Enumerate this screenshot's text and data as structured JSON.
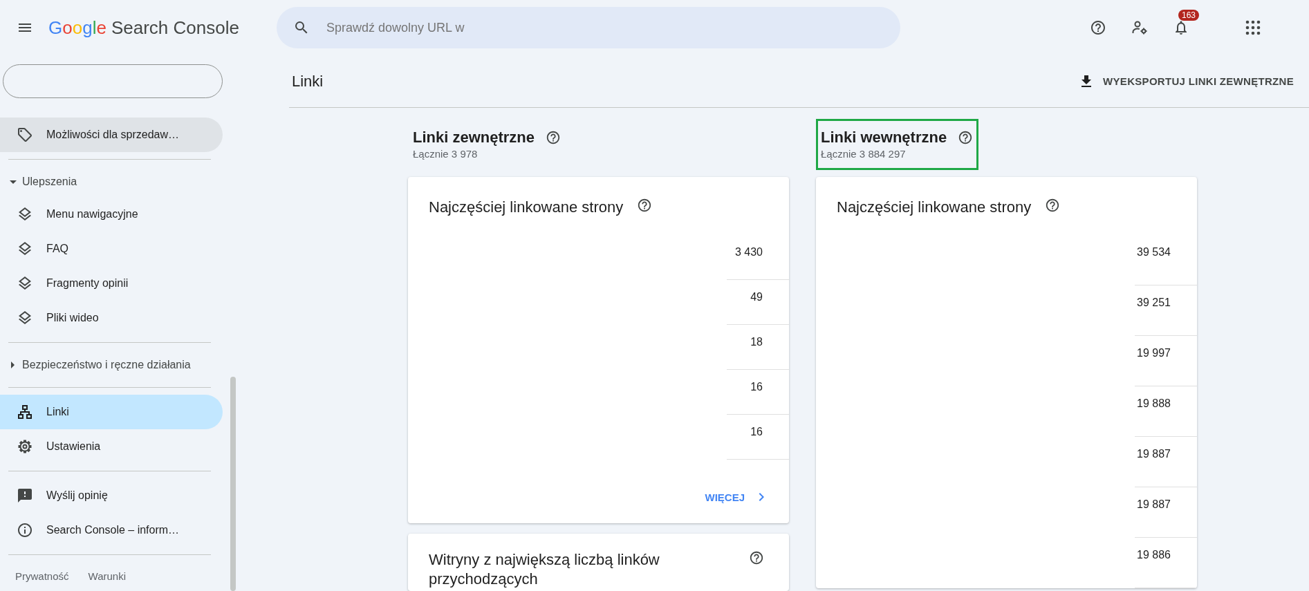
{
  "topbar": {
    "logo_brand": "Google",
    "logo_product": "Search Console",
    "search": {
      "placeholder": "Sprawdź dowolny URL w"
    },
    "notifications_badge": "163"
  },
  "sidebar": {
    "items": [
      {
        "kind": "link",
        "label": "Możliwości dla sprzedaw…",
        "selected": false,
        "highlighted": true
      },
      {
        "kind": "divider"
      },
      {
        "kind": "group",
        "label": "Ulepszenia",
        "expanded": true,
        "children": [
          {
            "kind": "link",
            "label": "Menu nawigacyjne",
            "selected": false,
            "highlighted": false
          },
          {
            "kind": "link",
            "label": "FAQ",
            "selected": false,
            "highlighted": false
          },
          {
            "kind": "link",
            "label": "Fragmenty opinii",
            "selected": false,
            "highlighted": false
          },
          {
            "kind": "link",
            "label": "Pliki wideo",
            "selected": false,
            "highlighted": false
          }
        ]
      },
      {
        "kind": "divider"
      },
      {
        "kind": "group",
        "label": "Bezpieczeństwo i ręczne działania",
        "expanded": false
      },
      {
        "kind": "divider"
      },
      {
        "kind": "link",
        "label": "Linki",
        "selected": true,
        "highlighted": false
      },
      {
        "kind": "link",
        "label": "Ustawienia",
        "selected": false,
        "highlighted": false
      },
      {
        "kind": "divider"
      },
      {
        "kind": "link",
        "label": "Wyślij opinię",
        "selected": false,
        "highlighted": false
      },
      {
        "kind": "link",
        "label": "Search Console – inform…",
        "selected": false,
        "highlighted": false
      },
      {
        "kind": "divider"
      }
    ],
    "footer_links": [
      "Prywatność",
      "Warunki"
    ]
  },
  "page": {
    "title": "Linki",
    "export_button": "WYEKSPORTUJ LINKI ZEWNĘTRZNE"
  },
  "sections": [
    {
      "title": "Linki zewnętrzne",
      "total": "Łącznie 3 978",
      "highlighted": false,
      "cards": [
        {
          "title": "Najczęściej linkowane strony",
          "rows": [
            {
              "value": "3 430"
            },
            {
              "value": "49"
            },
            {
              "value": "18"
            },
            {
              "value": "16"
            },
            {
              "value": "16"
            }
          ],
          "more_link": "WIĘCEJ"
        },
        {
          "title": "Witryny z największą liczbą linków przychodzących"
        }
      ]
    },
    {
      "title": "Linki wewnętrzne",
      "total": "Łącznie 3 884 297",
      "highlighted": true,
      "cards": [
        {
          "title": "Najczęściej linkowane strony",
          "rows": [
            {
              "value": "39 534"
            },
            {
              "value": "39 251"
            },
            {
              "value": "19 997"
            },
            {
              "value": "19 888"
            },
            {
              "value": "19 887"
            },
            {
              "value": "19 887"
            },
            {
              "value": "19 886"
            }
          ]
        }
      ]
    }
  ]
}
